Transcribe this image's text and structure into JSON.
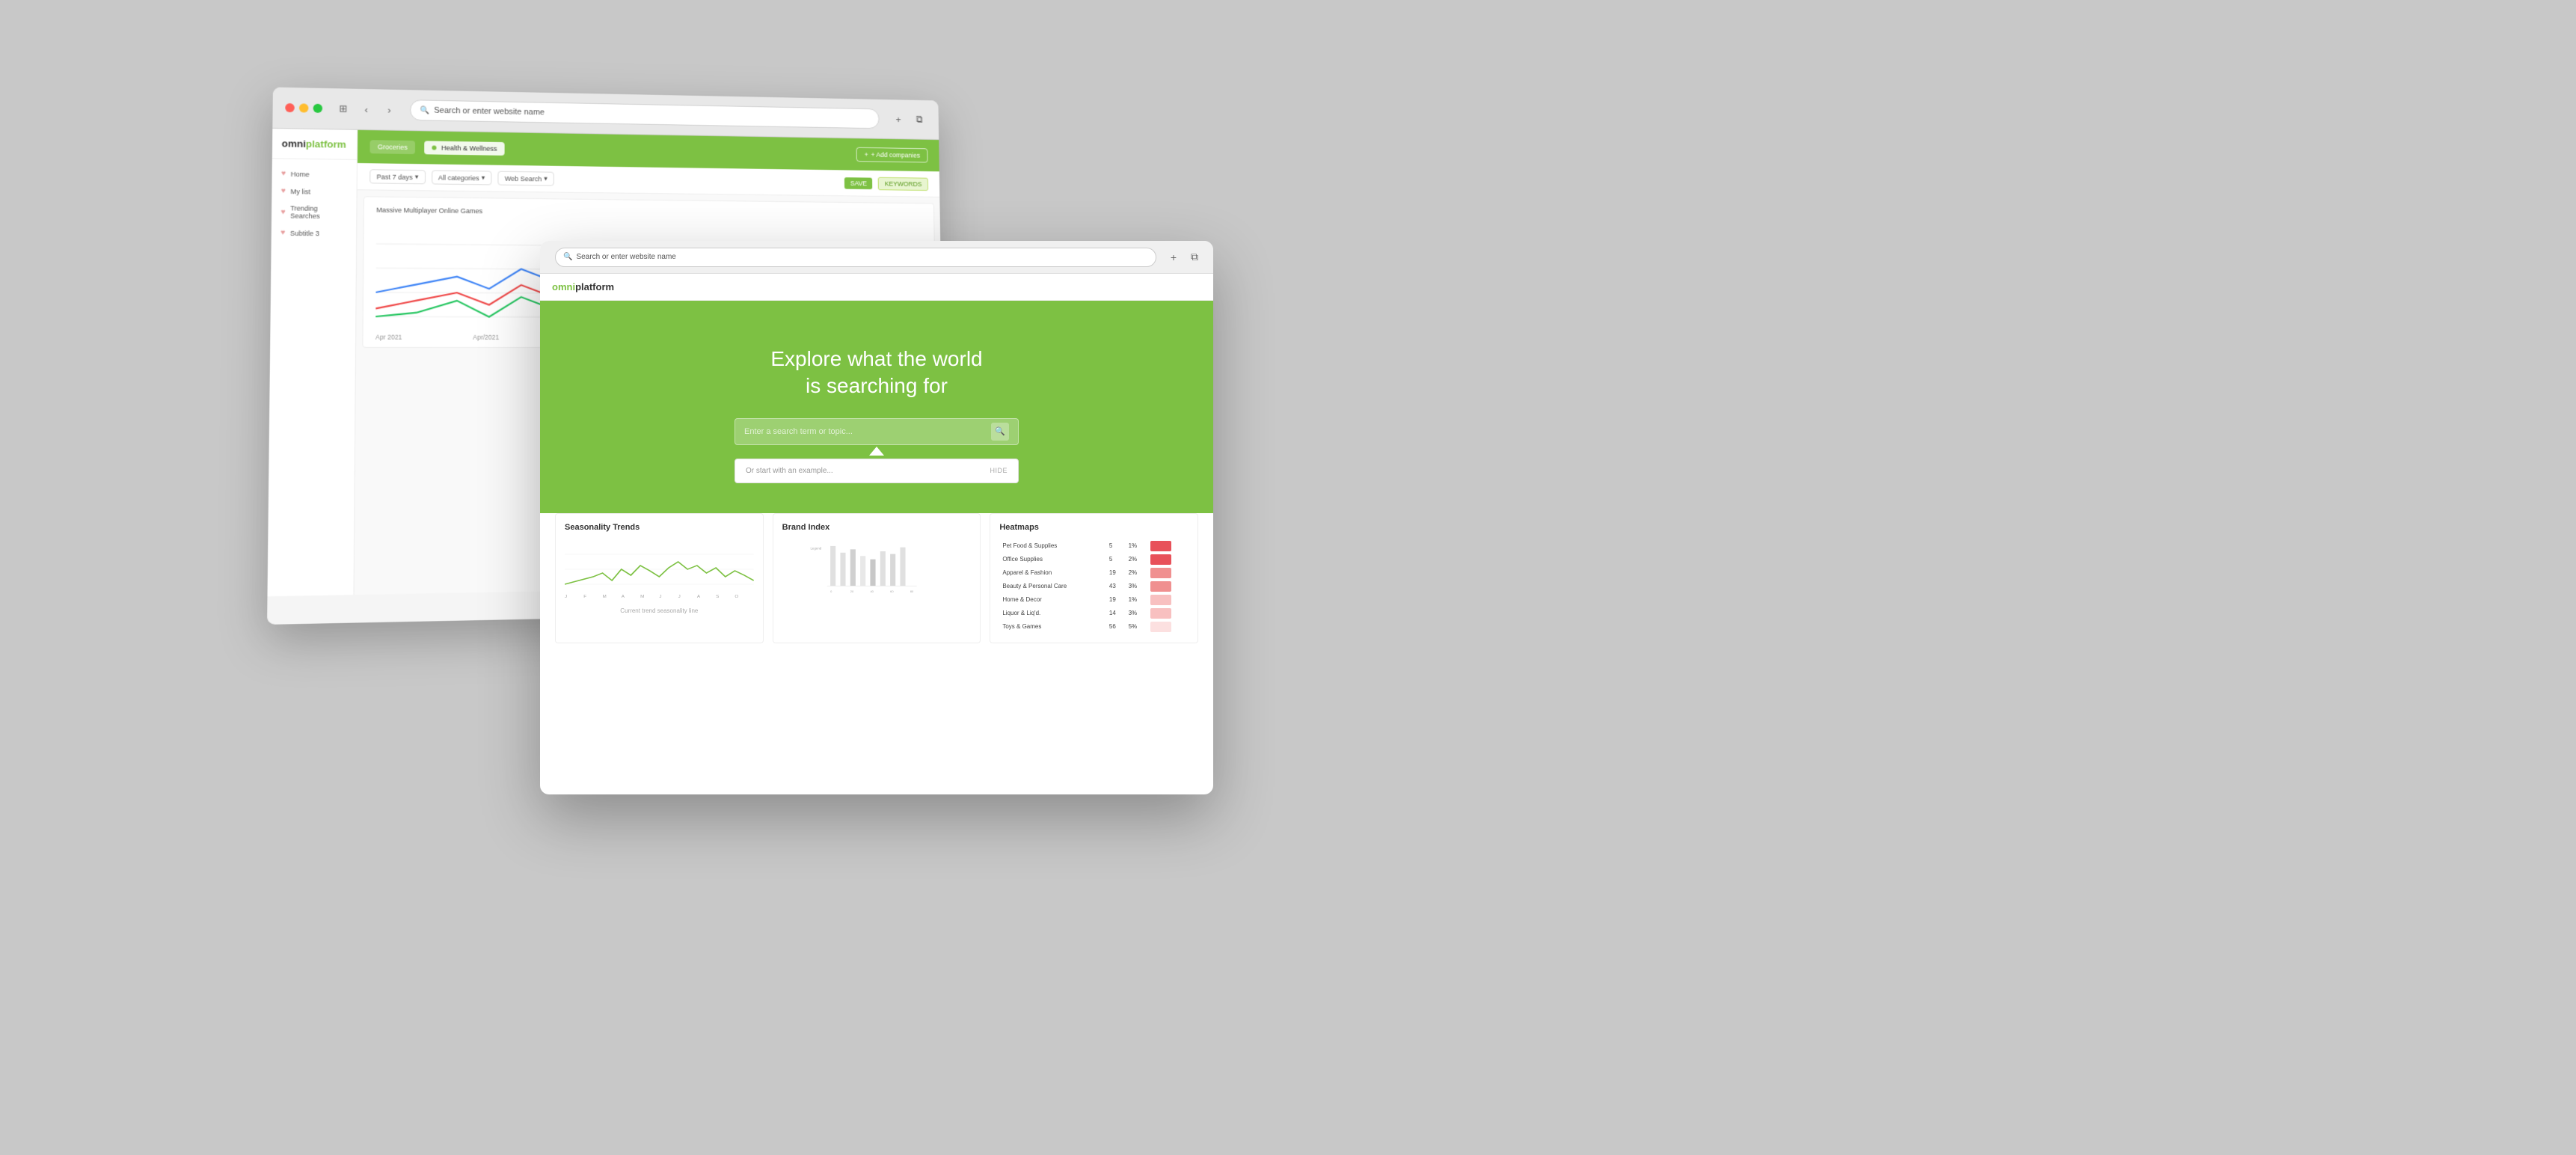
{
  "background_color": "#c8c8c8",
  "back_browser": {
    "url": "Search or enter website name",
    "brand": {
      "omni": "omni",
      "platform": "platform"
    },
    "nav_items": [
      {
        "label": "Home",
        "icon": "heart"
      },
      {
        "label": "My list",
        "icon": "heart"
      },
      {
        "label": "Trending Searches",
        "icon": "heart"
      },
      {
        "label": "Subtitle 3",
        "icon": "heart"
      }
    ],
    "categories": [
      "Groceries",
      "Health & Wellness"
    ],
    "add_companies": "+ Add companies",
    "filters": {
      "date": "Past 7 days",
      "categories": "All categories",
      "search_type": "Web Search"
    },
    "save_label": "SAVE",
    "keywords_label": "KEYWORDS",
    "chart_title": "Massive Multiplayer Online Games",
    "chart_legend": [
      "Massive Multiplayer Online Games"
    ]
  },
  "front_browser": {
    "url": "Search or enter website name",
    "brand": {
      "omni": "omni",
      "platform": "platform"
    },
    "hero": {
      "title_line1": "Explore what the world",
      "title_line2": "is searching for",
      "search_placeholder": "Enter a search term or topic...",
      "search_button": "🔍"
    },
    "search_dropdown": {
      "hint": "Or start with an example...",
      "hide_label": "HIDE"
    },
    "panels": {
      "seasonality": {
        "title": "Seasonality Trends"
      },
      "brand_index": {
        "title": "Brand Index"
      },
      "heatmaps": {
        "title": "Heatmaps",
        "rows": [
          {
            "category": "Pet Food & Supplies",
            "value": 5,
            "pct": "1%",
            "heat": "high"
          },
          {
            "category": "Office Supplies",
            "value": 5,
            "pct": "2%",
            "heat": "high"
          },
          {
            "category": "Apparel & Fashion",
            "value": 19,
            "pct": "2%",
            "heat": "med"
          },
          {
            "category": "Beauty & Personal Care",
            "value": 43,
            "pct": "3%",
            "heat": "med"
          },
          {
            "category": "Home & Decor",
            "value": 19,
            "pct": "1%",
            "heat": "low"
          },
          {
            "category": "Liquor & Liqd.",
            "value": 14,
            "pct": "3%",
            "heat": "low"
          },
          {
            "category": "Toys & Games",
            "value": 56,
            "pct": "5%",
            "heat": "vlow"
          }
        ]
      }
    },
    "plus_button": "+",
    "copy_button": "⧉"
  }
}
